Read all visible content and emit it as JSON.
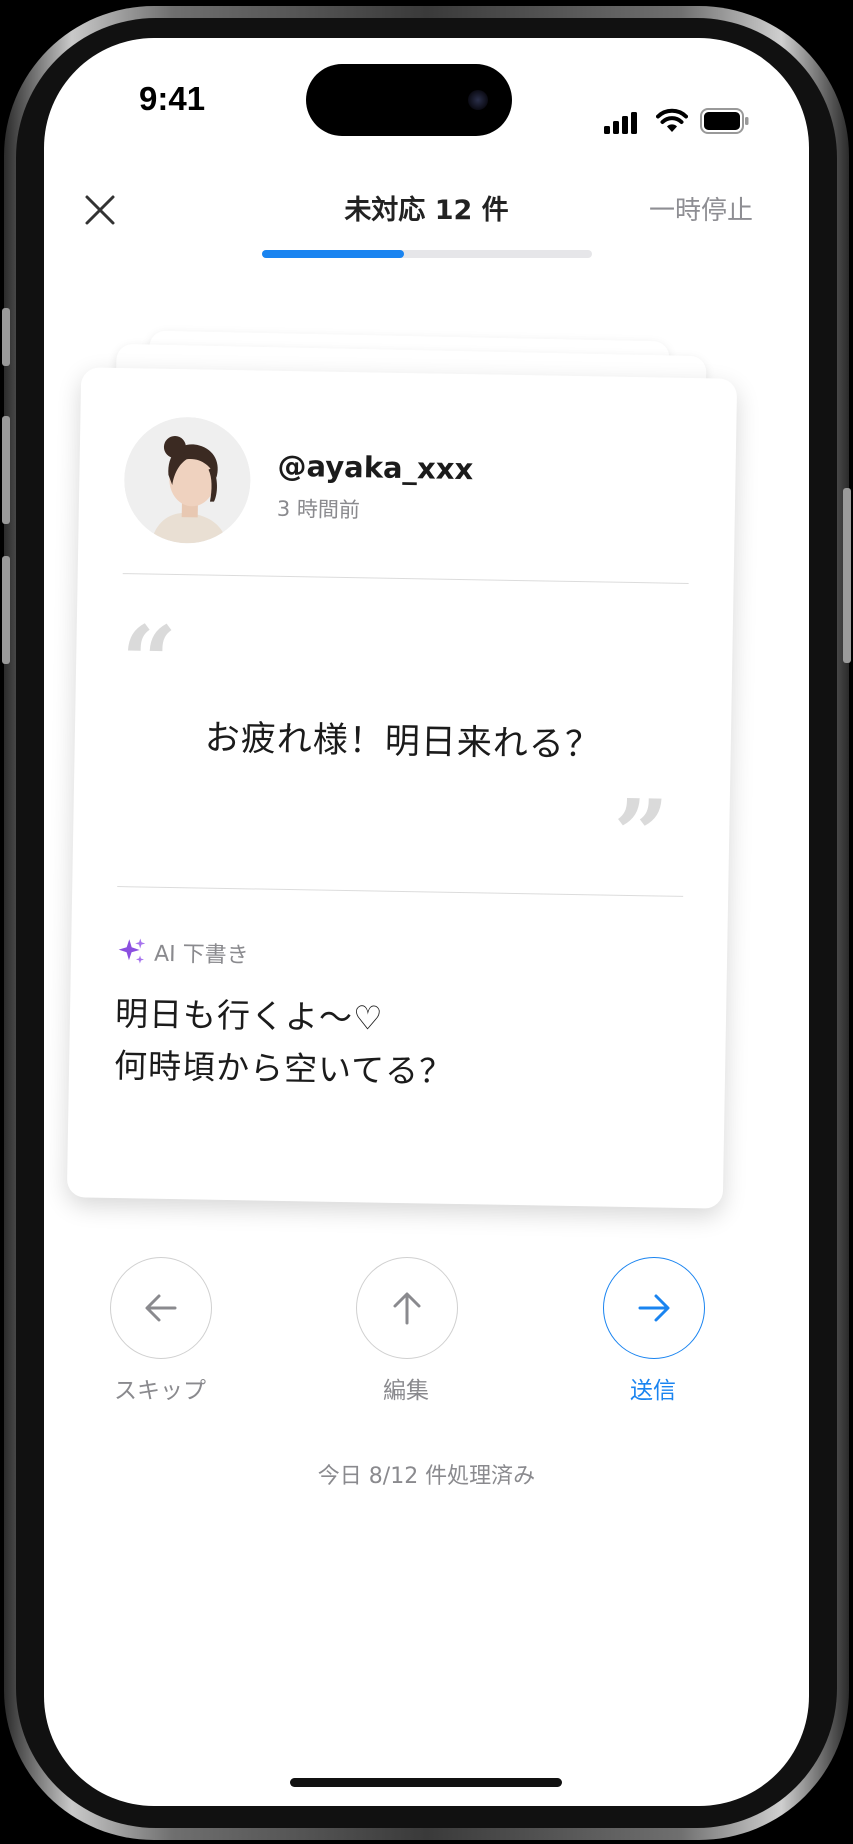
{
  "status_bar": {
    "time": "9:41"
  },
  "header": {
    "title": "未対応 12 件",
    "pause_label": "一時停止",
    "progress": 0.43
  },
  "card": {
    "handle": "@ayaka_xxx",
    "time_ago": "3 時間前",
    "message": "お疲れ様！明日来れる？",
    "ai_label": "AI 下書き",
    "draft": "明日も行くよ〜♡\n何時頃から空いてる？"
  },
  "actions": {
    "skip_label": "スキップ",
    "edit_label": "編集",
    "send_label": "送信"
  },
  "footer": {
    "summary": "今日 8/12 件処理済み"
  },
  "colors": {
    "accent": "#1a84f0",
    "sparkle": "#8b4fe0"
  },
  "icons": [
    "close-icon",
    "signal-icon",
    "wifi-icon",
    "battery-icon",
    "sparkle-icon",
    "arrow-left-icon",
    "arrow-up-icon",
    "arrow-right-icon"
  ]
}
